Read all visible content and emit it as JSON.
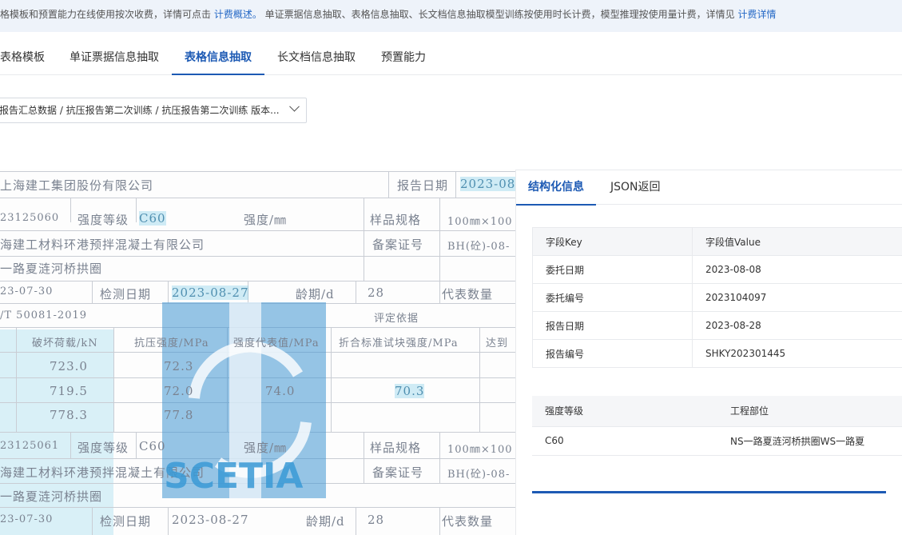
{
  "notice": {
    "prefix": "格模板和预置能力在线使用按次收费，详情可点击 ",
    "link1": "计费概述。",
    "middle": " 单证票据信息抽取、表格信息抽取、长文档信息抽取模型训练按使用时长计费，模型推理按使用量计费，详情见 ",
    "link2": "计费详情"
  },
  "tabs": [
    {
      "label": "表格模板"
    },
    {
      "label": "单证票据信息抽取"
    },
    {
      "label": "表格信息抽取"
    },
    {
      "label": "长文档信息抽取"
    },
    {
      "label": "预置能力"
    }
  ],
  "selector": {
    "value": "报告汇总数据 / 抗压报告第二次训练 / 抗压报告第二次训练 版本..."
  },
  "document": {
    "lines": [
      "上海建工集团股份有限公司",
      "报告日期",
      "2023-08",
      "23125060",
      "强度等级",
      "C60",
      "强度/㎜",
      "样品规格",
      "100㎜×100",
      "海建工材料环港预拌混凝土有限公司",
      "备案证号",
      "BH(砼)-08-",
      "一路夏涟河桥拱圈",
      "23-07-30",
      "检测日期",
      "2023-08-27",
      "龄期/d",
      "28",
      "代表数量",
      "/T 50081-2019",
      "评定依据",
      "破坏荷载/kN",
      "抗压强度/MPa",
      "强度代表值/MPa",
      "折合标准试块强度/MPa",
      "达到",
      "723.0",
      "72.3",
      "719.5",
      "72.0",
      "74.0",
      "70.3",
      "778.3",
      "77.8",
      "23125061",
      "强度等级",
      "C60",
      "强度/㎜",
      "样品规格",
      "100㎜×100",
      "海建工材料环港预拌混凝土有限公司",
      "备案证号",
      "BH(砼)-08-",
      "一路夏涟河桥拱圈",
      "23-07-30",
      "检测日期",
      "2023-08-27",
      "龄期/d",
      "28",
      "代表数量"
    ],
    "watermark": "SCETIA"
  },
  "panel": {
    "tabs": [
      {
        "label": "结构化信息"
      },
      {
        "label": "JSON返回"
      }
    ],
    "kv_header": {
      "key": "字段Key",
      "value": "字段值Value"
    },
    "kv_rows": [
      {
        "key": "委托日期",
        "value": "2023-08-08"
      },
      {
        "key": "委托编号",
        "value": "2023104097"
      },
      {
        "key": "报告日期",
        "value": "2023-08-28"
      },
      {
        "key": "报告编号",
        "value": "SHKY202301445"
      }
    ],
    "table_header": [
      "强度等级",
      "工程部位"
    ],
    "table_rows": [
      [
        "C60",
        "NS一路夏涟河桥拱圈WS一路夏"
      ]
    ]
  },
  "colors": {
    "accent": "#1d5ab4",
    "notice_bg": "#eef3fa"
  }
}
